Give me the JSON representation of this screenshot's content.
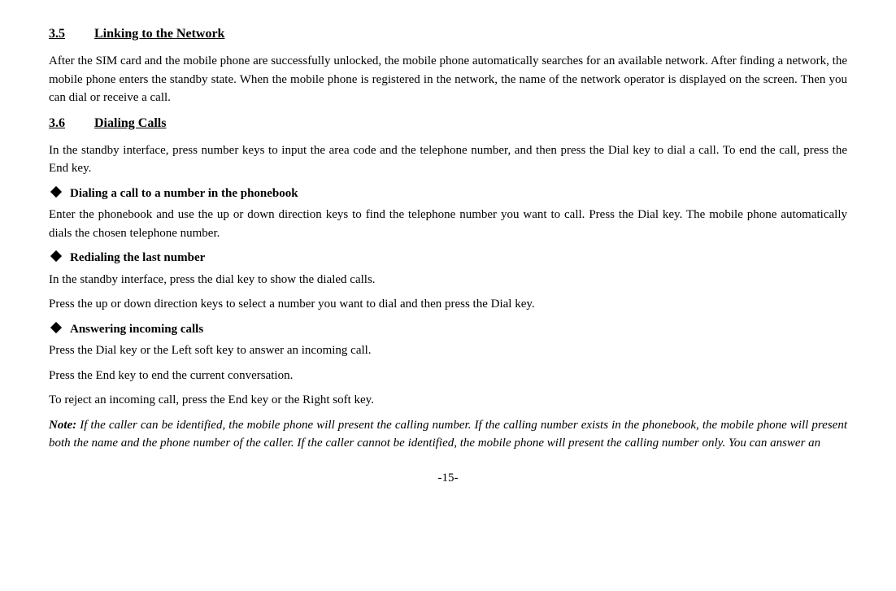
{
  "sections": [
    {
      "id": "section-3-5",
      "number": "3.5",
      "title": "Linking to the Network",
      "content": [
        {
          "type": "paragraph",
          "text": "After the SIM card and the mobile phone are successfully unlocked, the mobile phone automatically searches for an available network. After finding a network, the mobile phone enters the standby state. When the mobile phone is registered in the network, the name of the network operator is displayed on the screen. Then you can dial or receive a call."
        }
      ]
    },
    {
      "id": "section-3-6",
      "number": "3.6",
      "title": "Dialing Calls",
      "content": [
        {
          "type": "paragraph",
          "text": "In the standby interface, press number keys to input the area code and the telephone number, and then press the Dial key to dial a call. To end the call, press the End key."
        },
        {
          "type": "bullet",
          "heading": "Dialing a call to a number in the phonebook",
          "paragraphs": [
            "Enter the phonebook and use the up or down direction keys to find the telephone number you want to call. Press the Dial key. The mobile phone automatically dials the chosen telephone number."
          ]
        },
        {
          "type": "bullet",
          "heading": "Redialing the last number",
          "paragraphs": [
            "In the standby interface, press the dial key to show the dialed calls.",
            "Press the up or down direction keys to select a number you want to dial and then press the Dial key."
          ]
        },
        {
          "type": "bullet",
          "heading": "Answering incoming calls",
          "paragraphs": [
            "Press the Dial key or the Left soft key to answer an incoming call.",
            "Press the End key to end the current conversation.",
            "To reject an incoming call, press the End key or the Right soft key."
          ]
        },
        {
          "type": "note",
          "label": "Note:",
          "text": " If the caller can be identified, the mobile phone will present the calling number. If the calling number exists in the phonebook, the mobile phone will present both the name and the phone number of the caller. If the caller cannot be identified, the mobile phone will present the calling number only. You can answer an"
        }
      ]
    }
  ],
  "page_number": "-15-"
}
